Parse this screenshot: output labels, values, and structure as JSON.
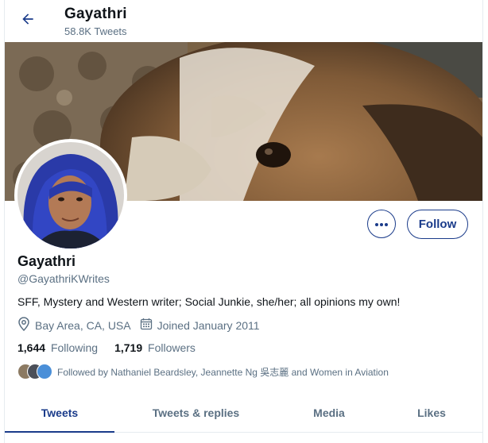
{
  "header": {
    "name": "Gayathri",
    "tweet_count": "58.8K Tweets"
  },
  "profile": {
    "display_name": "Gayathri",
    "handle": "@GayathriKWrites",
    "bio": "SFF, Mystery and Western writer; Social Junkie, she/her; all opinions my own!",
    "location": "Bay Area, CA, USA",
    "joined": "Joined January 2011",
    "following_count": "1,644",
    "following_label": "Following",
    "followers_count": "1,719",
    "followers_label": "Followers",
    "followed_by": "Followed by Nathaniel Beardsley, Jeannette Ng 吳志麗 and Women in Aviation"
  },
  "actions": {
    "follow_label": "Follow"
  },
  "tabs": [
    {
      "label": "Tweets",
      "active": true
    },
    {
      "label": "Tweets & replies",
      "active": false
    },
    {
      "label": "Media",
      "active": false
    },
    {
      "label": "Likes",
      "active": false
    }
  ],
  "colors": {
    "accent": "#1a3b8a",
    "muted_text": "#5b7083",
    "primary_text": "#0f1419"
  },
  "icons": {
    "back": "arrow-left-icon",
    "more": "more-horizontal-icon",
    "location": "location-pin-icon",
    "calendar": "calendar-icon"
  }
}
